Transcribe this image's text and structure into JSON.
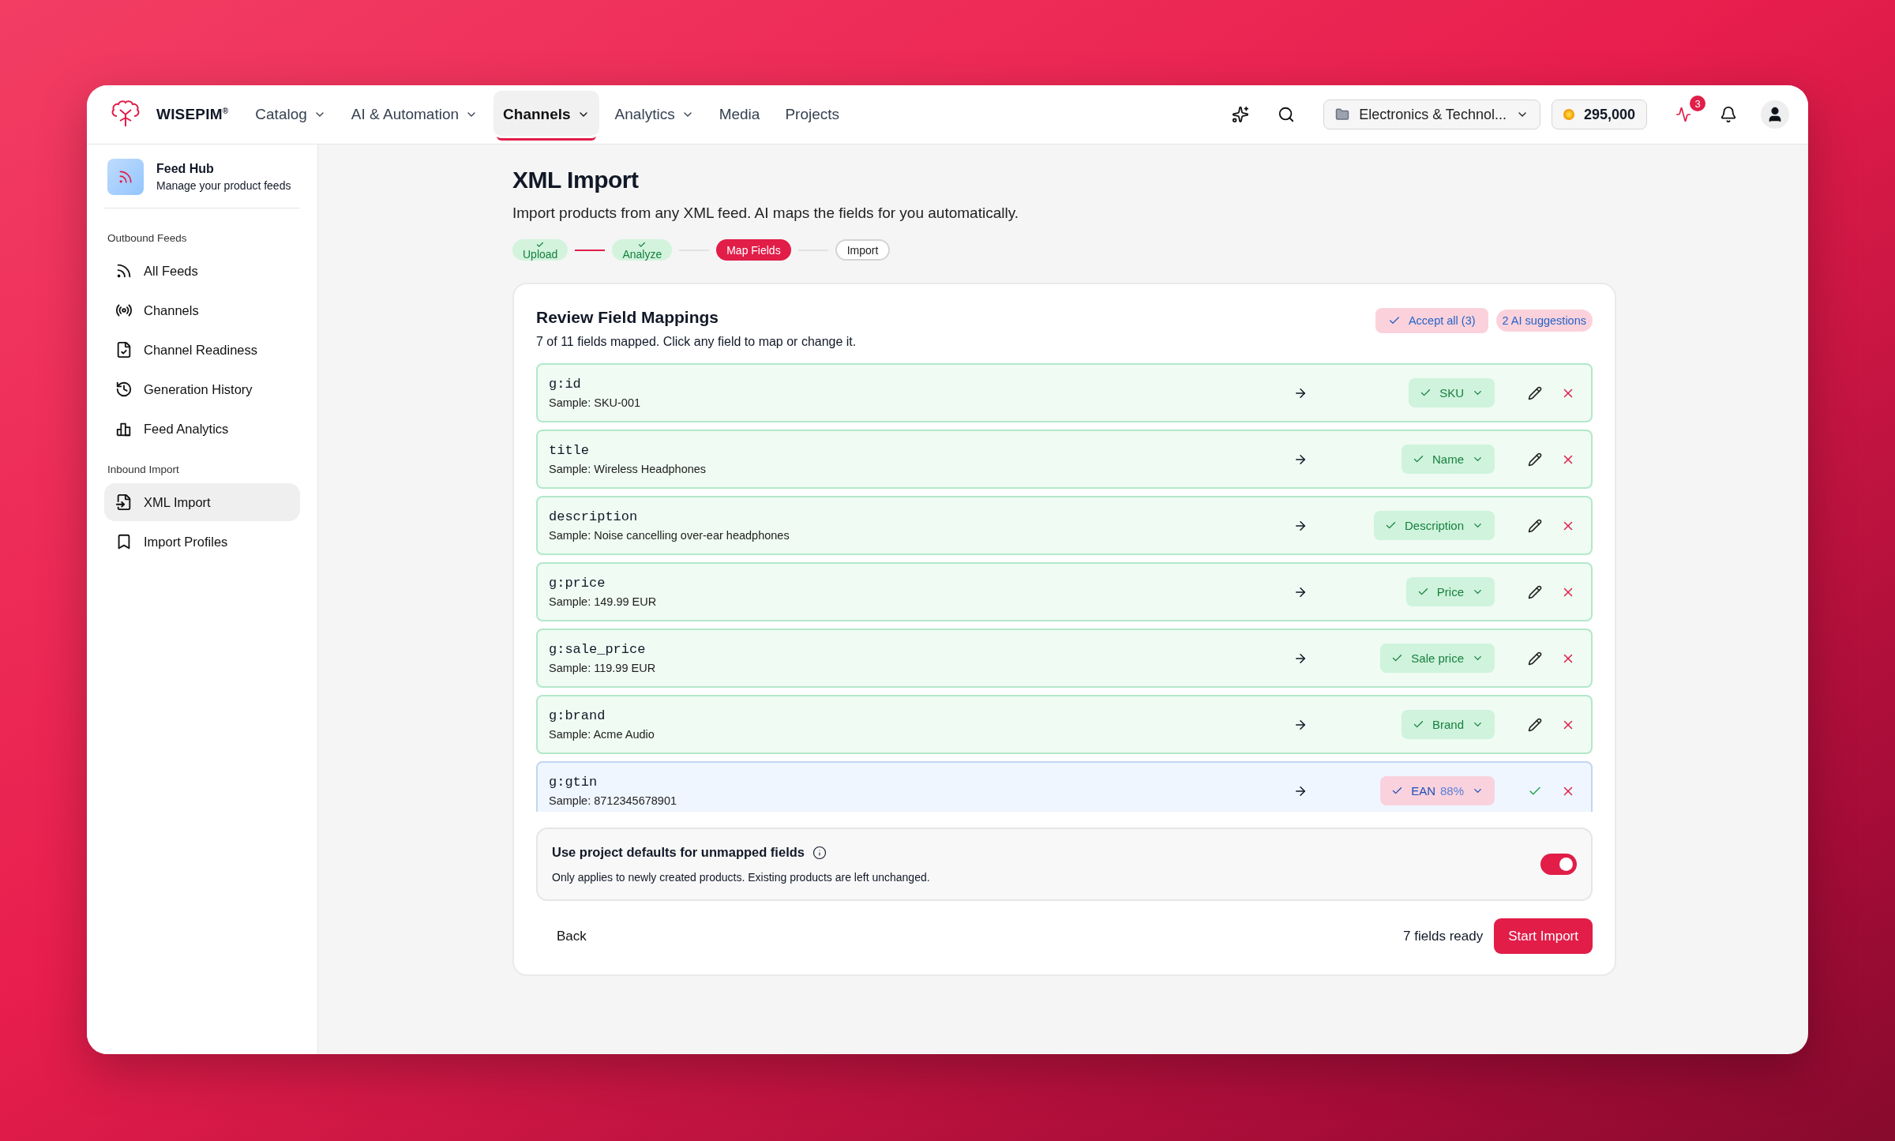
{
  "brand": {
    "name": "WISEPIM$^{®}$"
  },
  "nav": [
    {
      "label": "Catalog",
      "has_menu": true,
      "selected": false
    },
    {
      "label": "AI & Automation",
      "has_menu": true,
      "selected": false
    },
    {
      "label": "Channels",
      "has_menu": true,
      "selected": true
    },
    {
      "label": "Analytics",
      "has_menu": true,
      "selected": false
    },
    {
      "label": "Media",
      "has_menu": false,
      "selected": false
    },
    {
      "label": "Projects",
      "has_menu": false,
      "selected": false
    }
  ],
  "header": {
    "project": "Electronics & Technol...",
    "credits": "295,000",
    "activity_badge": "3"
  },
  "sidebar": {
    "title": "Feed Hub",
    "subtitle": "Manage your product feeds",
    "groups": [
      {
        "label": "Outbound Feeds",
        "items": [
          {
            "label": "All Feeds",
            "selected": false
          },
          {
            "label": "Channels",
            "selected": false
          },
          {
            "label": "Channel Readiness",
            "selected": false
          },
          {
            "label": "Generation History",
            "selected": false
          },
          {
            "label": "Feed Analytics",
            "selected": false
          }
        ]
      },
      {
        "label": "Inbound Import",
        "items": [
          {
            "label": "XML Import",
            "selected": true
          },
          {
            "label": "Import Profiles",
            "selected": false
          }
        ]
      }
    ]
  },
  "page": {
    "title": "XML Import",
    "subtitle": "Import products from any XML feed. AI maps the fields for you automatically."
  },
  "steps": [
    {
      "label": "Upload",
      "done": true,
      "selected": false
    },
    {
      "label": "Analyze",
      "done": true,
      "selected": false
    },
    {
      "label": "Map Fields",
      "done": false,
      "selected": true
    },
    {
      "label": "Import",
      "done": false,
      "selected": false
    }
  ],
  "card": {
    "title": "Review Field Mappings",
    "subtitle": "7 of 11 fields mapped. Click any field to map or change it.",
    "accept_all": "Accept all (3)",
    "suggestions": "2 AI suggestions"
  },
  "mappings": [
    {
      "kind": "mapped",
      "field": "g:id",
      "sample": "Sample: SKU-001",
      "target": "SKU"
    },
    {
      "kind": "mapped",
      "field": "title",
      "sample": "Sample: Wireless Headphones",
      "target": "Name"
    },
    {
      "kind": "mapped",
      "field": "description",
      "sample": "Sample: Noise cancelling over-ear headphones",
      "target": "Description"
    },
    {
      "kind": "mapped",
      "field": "g:price",
      "sample": "Sample: 149.99 EUR",
      "target": "Price"
    },
    {
      "kind": "mapped",
      "field": "g:sale_price",
      "sample": "Sample: 119.99 EUR",
      "target": "Sale price"
    },
    {
      "kind": "mapped",
      "field": "g:brand",
      "sample": "Sample: Acme Audio",
      "target": "Brand"
    },
    {
      "kind": "suggested",
      "field": "g:gtin",
      "sample": "Sample: 8712345678901",
      "target": "EAN",
      "confidence": "88%"
    }
  ],
  "defaults": {
    "title": "Use project defaults for unmapped fields",
    "description": "Only applies to newly created products. Existing products are left unchanged.",
    "on": true
  },
  "footer": {
    "back": "Back",
    "status": "7 fields ready",
    "start": "Start Import"
  }
}
